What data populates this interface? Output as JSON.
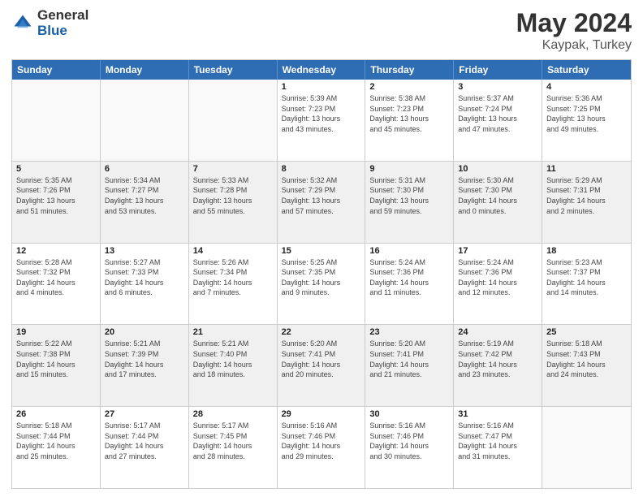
{
  "header": {
    "logo_general": "General",
    "logo_blue": "Blue",
    "title": "May 2024",
    "location": "Kaypak, Turkey"
  },
  "days_of_week": [
    "Sunday",
    "Monday",
    "Tuesday",
    "Wednesday",
    "Thursday",
    "Friday",
    "Saturday"
  ],
  "rows": [
    [
      {
        "day": "",
        "info": ""
      },
      {
        "day": "",
        "info": ""
      },
      {
        "day": "",
        "info": ""
      },
      {
        "day": "1",
        "info": "Sunrise: 5:39 AM\nSunset: 7:23 PM\nDaylight: 13 hours\nand 43 minutes."
      },
      {
        "day": "2",
        "info": "Sunrise: 5:38 AM\nSunset: 7:23 PM\nDaylight: 13 hours\nand 45 minutes."
      },
      {
        "day": "3",
        "info": "Sunrise: 5:37 AM\nSunset: 7:24 PM\nDaylight: 13 hours\nand 47 minutes."
      },
      {
        "day": "4",
        "info": "Sunrise: 5:36 AM\nSunset: 7:25 PM\nDaylight: 13 hours\nand 49 minutes."
      }
    ],
    [
      {
        "day": "5",
        "info": "Sunrise: 5:35 AM\nSunset: 7:26 PM\nDaylight: 13 hours\nand 51 minutes."
      },
      {
        "day": "6",
        "info": "Sunrise: 5:34 AM\nSunset: 7:27 PM\nDaylight: 13 hours\nand 53 minutes."
      },
      {
        "day": "7",
        "info": "Sunrise: 5:33 AM\nSunset: 7:28 PM\nDaylight: 13 hours\nand 55 minutes."
      },
      {
        "day": "8",
        "info": "Sunrise: 5:32 AM\nSunset: 7:29 PM\nDaylight: 13 hours\nand 57 minutes."
      },
      {
        "day": "9",
        "info": "Sunrise: 5:31 AM\nSunset: 7:30 PM\nDaylight: 13 hours\nand 59 minutes."
      },
      {
        "day": "10",
        "info": "Sunrise: 5:30 AM\nSunset: 7:30 PM\nDaylight: 14 hours\nand 0 minutes."
      },
      {
        "day": "11",
        "info": "Sunrise: 5:29 AM\nSunset: 7:31 PM\nDaylight: 14 hours\nand 2 minutes."
      }
    ],
    [
      {
        "day": "12",
        "info": "Sunrise: 5:28 AM\nSunset: 7:32 PM\nDaylight: 14 hours\nand 4 minutes."
      },
      {
        "day": "13",
        "info": "Sunrise: 5:27 AM\nSunset: 7:33 PM\nDaylight: 14 hours\nand 6 minutes."
      },
      {
        "day": "14",
        "info": "Sunrise: 5:26 AM\nSunset: 7:34 PM\nDaylight: 14 hours\nand 7 minutes."
      },
      {
        "day": "15",
        "info": "Sunrise: 5:25 AM\nSunset: 7:35 PM\nDaylight: 14 hours\nand 9 minutes."
      },
      {
        "day": "16",
        "info": "Sunrise: 5:24 AM\nSunset: 7:36 PM\nDaylight: 14 hours\nand 11 minutes."
      },
      {
        "day": "17",
        "info": "Sunrise: 5:24 AM\nSunset: 7:36 PM\nDaylight: 14 hours\nand 12 minutes."
      },
      {
        "day": "18",
        "info": "Sunrise: 5:23 AM\nSunset: 7:37 PM\nDaylight: 14 hours\nand 14 minutes."
      }
    ],
    [
      {
        "day": "19",
        "info": "Sunrise: 5:22 AM\nSunset: 7:38 PM\nDaylight: 14 hours\nand 15 minutes."
      },
      {
        "day": "20",
        "info": "Sunrise: 5:21 AM\nSunset: 7:39 PM\nDaylight: 14 hours\nand 17 minutes."
      },
      {
        "day": "21",
        "info": "Sunrise: 5:21 AM\nSunset: 7:40 PM\nDaylight: 14 hours\nand 18 minutes."
      },
      {
        "day": "22",
        "info": "Sunrise: 5:20 AM\nSunset: 7:41 PM\nDaylight: 14 hours\nand 20 minutes."
      },
      {
        "day": "23",
        "info": "Sunrise: 5:20 AM\nSunset: 7:41 PM\nDaylight: 14 hours\nand 21 minutes."
      },
      {
        "day": "24",
        "info": "Sunrise: 5:19 AM\nSunset: 7:42 PM\nDaylight: 14 hours\nand 23 minutes."
      },
      {
        "day": "25",
        "info": "Sunrise: 5:18 AM\nSunset: 7:43 PM\nDaylight: 14 hours\nand 24 minutes."
      }
    ],
    [
      {
        "day": "26",
        "info": "Sunrise: 5:18 AM\nSunset: 7:44 PM\nDaylight: 14 hours\nand 25 minutes."
      },
      {
        "day": "27",
        "info": "Sunrise: 5:17 AM\nSunset: 7:44 PM\nDaylight: 14 hours\nand 27 minutes."
      },
      {
        "day": "28",
        "info": "Sunrise: 5:17 AM\nSunset: 7:45 PM\nDaylight: 14 hours\nand 28 minutes."
      },
      {
        "day": "29",
        "info": "Sunrise: 5:16 AM\nSunset: 7:46 PM\nDaylight: 14 hours\nand 29 minutes."
      },
      {
        "day": "30",
        "info": "Sunrise: 5:16 AM\nSunset: 7:46 PM\nDaylight: 14 hours\nand 30 minutes."
      },
      {
        "day": "31",
        "info": "Sunrise: 5:16 AM\nSunset: 7:47 PM\nDaylight: 14 hours\nand 31 minutes."
      },
      {
        "day": "",
        "info": ""
      }
    ]
  ]
}
